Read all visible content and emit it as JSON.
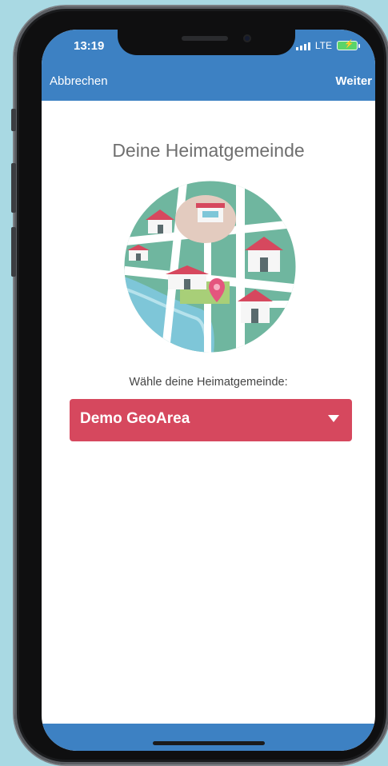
{
  "status_bar": {
    "time": "13:19",
    "network": "LTE"
  },
  "nav": {
    "cancel": "Abbrechen",
    "next": "Weiter"
  },
  "main": {
    "title": "Deine Heimatgemeinde",
    "prompt": "Wähle deine Heimatgemeinde:",
    "select": {
      "value": "Demo GeoArea"
    }
  },
  "icons": [
    "map-illustration",
    "location-pin-icon",
    "chevron-down-icon",
    "battery-icon",
    "signal-icon"
  ],
  "colors": {
    "nav": "#3d81c3",
    "accent": "#d6485e",
    "map_green": "#6fb69f",
    "background": "#a9d9e3"
  }
}
